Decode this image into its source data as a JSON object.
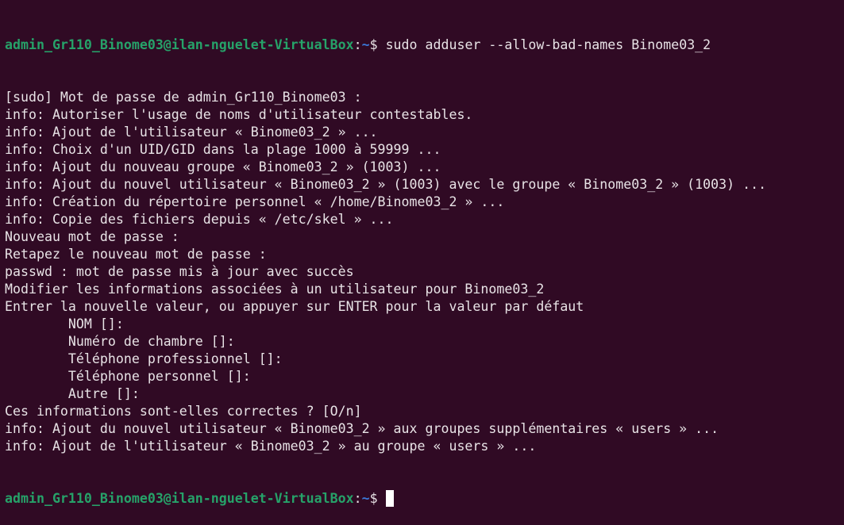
{
  "prompt": {
    "user_host": "admin_Gr110_Binome03@ilan-nguelet-VirtualBox",
    "colon": ":",
    "path": "~",
    "symbol": "$ "
  },
  "command": "sudo adduser --allow-bad-names Binome03_2",
  "output": [
    "[sudo] Mot de passe de admin_Gr110_Binome03 :",
    "info: Autoriser l'usage de noms d'utilisateur contestables.",
    "info: Ajout de l'utilisateur « Binome03_2 » ...",
    "info: Choix d'un UID/GID dans la plage 1000 à 59999 ...",
    "info: Ajout du nouveau groupe « Binome03_2 » (1003) ...",
    "info: Ajout du nouvel utilisateur « Binome03_2 » (1003) avec le groupe « Binome03_2 » (1003) ...",
    "info: Création du répertoire personnel « /home/Binome03_2 » ...",
    "info: Copie des fichiers depuis « /etc/skel » ...",
    "Nouveau mot de passe :",
    "Retapez le nouveau mot de passe :",
    "passwd : mot de passe mis à jour avec succès",
    "Modifier les informations associées à un utilisateur pour Binome03_2",
    "Entrer la nouvelle valeur, ou appuyer sur ENTER pour la valeur par défaut",
    "        NOM []:",
    "        Numéro de chambre []:",
    "        Téléphone professionnel []:",
    "        Téléphone personnel []:",
    "        Autre []:",
    "Ces informations sont-elles correctes ? [O/n]",
    "info: Ajout du nouvel utilisateur « Binome03_2 » aux groupes supplémentaires « users » ...",
    "info: Ajout de l'utilisateur « Binome03_2 » au groupe « users » ..."
  ],
  "colors": {
    "background": "#300a24",
    "prompt_user": "#26a269",
    "prompt_path": "#3b78d8",
    "text": "#e8e3e6"
  }
}
